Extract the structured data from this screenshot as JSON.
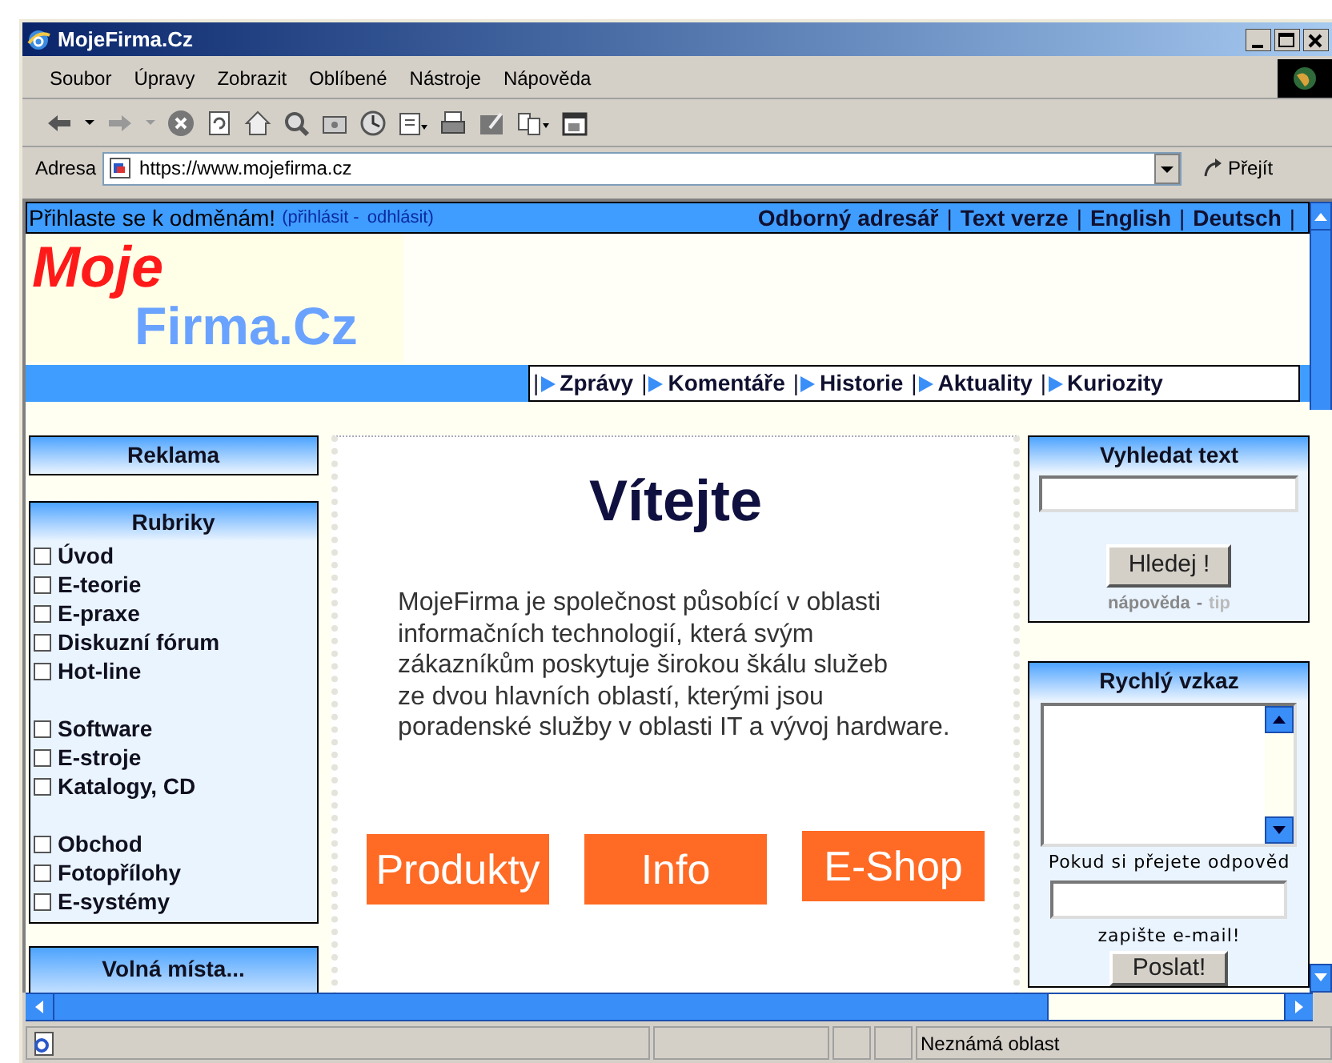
{
  "window": {
    "title": "MojeFirma.Cz"
  },
  "menu": [
    "Soubor",
    "Úpravy",
    "Zobrazit",
    "Oblíbené",
    "Nástroje",
    "Nápověda"
  ],
  "address": {
    "label": "Adresa",
    "url": "https://www.mojefirma.cz",
    "go": "Přejít"
  },
  "top_bar": {
    "prompt": "Přihlaste se k odměnám!",
    "login": "(přihlásit",
    "dash": "-",
    "logout": "odhlásit)",
    "links": [
      "Odborný adresář",
      "Text verze",
      "English",
      "Deutsch"
    ],
    "separator": "|"
  },
  "logo": {
    "line_1": "Moje",
    "line_2": "Firma.Cz"
  },
  "nav": {
    "separator": "|",
    "items": [
      "Zprávy",
      "Komentáře",
      "Historie",
      "Aktuality",
      "Kuriozity"
    ]
  },
  "left": {
    "ad_title": "Reklama",
    "rubriky_title": "Rubriky",
    "groups": [
      [
        {
          "label": "Úvod",
          "checked": false
        },
        {
          "label": "E-teorie",
          "checked": false
        },
        {
          "label": "E-praxe",
          "checked": false
        },
        {
          "label": "Diskuzní fórum",
          "checked": false
        },
        {
          "label": "Hot-line",
          "checked": false
        }
      ],
      [
        {
          "label": "Software",
          "checked": false
        },
        {
          "label": "E-stroje",
          "checked": false
        },
        {
          "label": "Katalogy, CD",
          "checked": false
        }
      ],
      [
        {
          "label": "Obchod",
          "checked": false
        },
        {
          "label": "Fotopřílohy",
          "checked": false
        },
        {
          "label": "E-systémy",
          "checked": false
        }
      ]
    ],
    "jobs_title": "Volná místa..."
  },
  "main": {
    "heading": "Vítejte",
    "paragraph_lines": [
      "MojeFirma je společnost působící v oblasti",
      "informačních technologií, která svým",
      "zákazníkům poskytuje širokou škálu služeb",
      "ze dvou hlavních oblastí, kterými jsou",
      "poradenské služby v oblasti IT a vývoj hardware."
    ],
    "buttons": [
      "Produkty",
      "Info",
      "E-Shop"
    ]
  },
  "search": {
    "title": "Vyhledat text",
    "button": "Hledej !",
    "help": "nápověda",
    "dash": "-",
    "tip": "tip"
  },
  "message": {
    "title": "Rychlý vzkaz",
    "prompt": "Pokud si přejete odpověd",
    "email_hint": "zapište e-mail!",
    "button": "Poslat!"
  },
  "status_bar": {
    "zone": "Neznámá oblast"
  }
}
